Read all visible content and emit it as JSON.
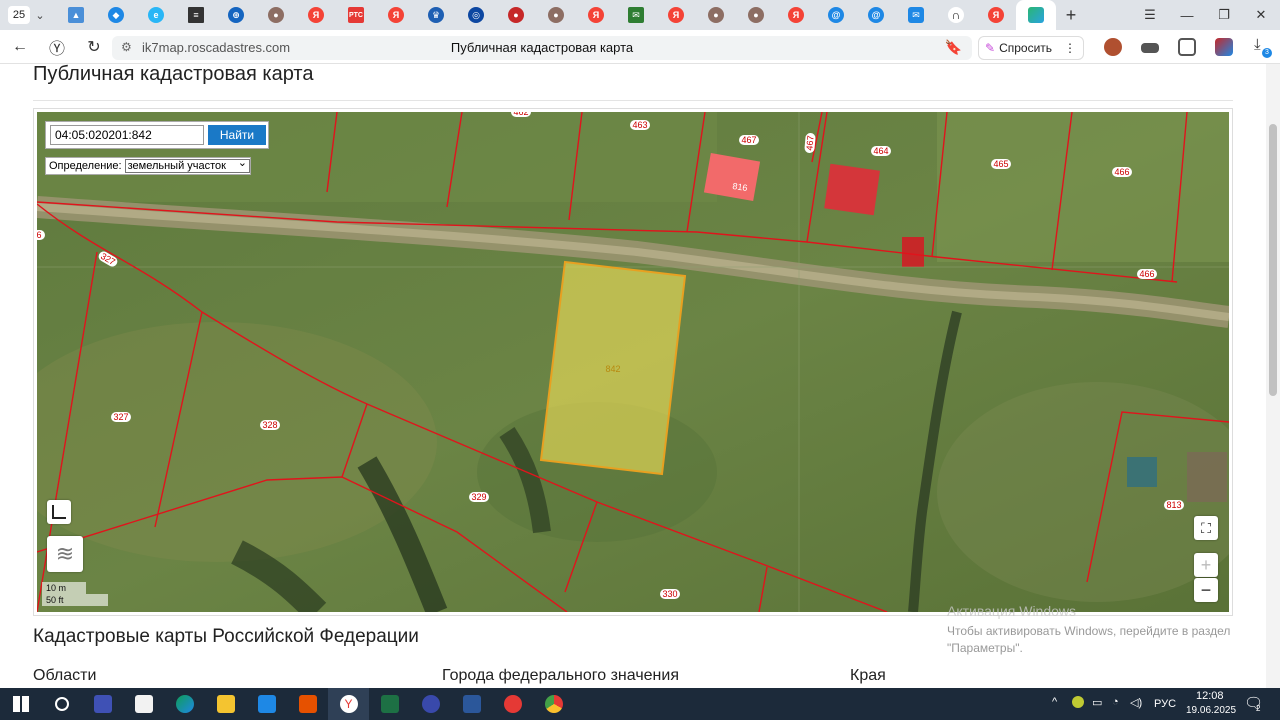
{
  "browser": {
    "tab_count": "25",
    "url_host": "ik7map.roscadastres.com",
    "page_title": "Публичная кадастровая карта",
    "ask_label": "Спросить",
    "download_badge": "3"
  },
  "page": {
    "heading": "Публичная кадастровая карта"
  },
  "map": {
    "search_value": "04:05:020201:842",
    "search_button": "Найти",
    "definition_label": "Определение:",
    "definition_value": "земельный участок",
    "selected_parcel": "842",
    "parcel_labels": [
      "462",
      "463",
      "467",
      "467",
      "464",
      "465",
      "466",
      "466",
      "816",
      "327",
      "327",
      "328",
      "329",
      "330",
      "813",
      "6"
    ],
    "scale_metric": "10 m",
    "scale_imperial": "50 ft",
    "colors": {
      "boundary": "#e0141c",
      "selected_fill": "#f3e35a",
      "selected_stroke": "#e8a020",
      "search_button": "#1a79c7"
    }
  },
  "watermark": {
    "title": "Активация Windows",
    "text": "Чтобы активировать Windows, перейдите в раздел \"Параметры\"."
  },
  "section": {
    "title": "Кадастровые карты Российской Федерации",
    "columns": [
      "Области",
      "Города федерального значения",
      "Края"
    ]
  },
  "taskbar": {
    "language": "РУС",
    "time": "12:08",
    "date": "19.06.2025",
    "notification_count": "2"
  }
}
